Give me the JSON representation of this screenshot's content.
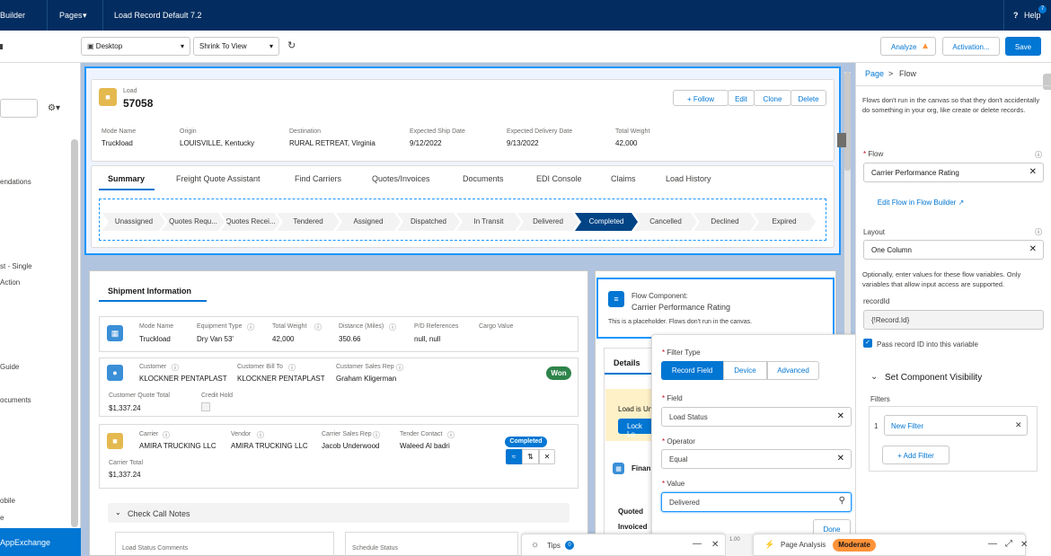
{
  "topbar": {
    "app": "Builder",
    "pages": "Pages",
    "title": "Load Record Default 7.2",
    "help": "Help",
    "help_badge": "7"
  },
  "toolbar": {
    "device": "Desktop",
    "zoom": "Shrink To View",
    "analyze": "Analyze",
    "activation": "Activation...",
    "save": "Save"
  },
  "left_panel": {
    "items": [
      "endations",
      "st - Single",
      "Action",
      "Guide",
      "ocuments",
      "obile",
      "e"
    ],
    "appexchange": "AppExchange"
  },
  "record": {
    "object_label": "Load",
    "name": "57058",
    "actions": [
      "Follow",
      "Edit",
      "Clone",
      "Delete"
    ],
    "fields": [
      {
        "label": "Mode Name",
        "value": "Truckload"
      },
      {
        "label": "Origin",
        "value": "LOUISVILLE, Kentucky"
      },
      {
        "label": "Destination",
        "value": "RURAL RETREAT, Virginia"
      },
      {
        "label": "Expected Ship Date",
        "value": "9/12/2022"
      },
      {
        "label": "Expected Delivery Date",
        "value": "9/13/2022"
      },
      {
        "label": "Total Weight",
        "value": "42,000"
      }
    ]
  },
  "tabs": [
    "Summary",
    "Freight Quote Assistant",
    "Find Carriers",
    "Quotes/Invoices",
    "Documents",
    "EDI Console",
    "Claims",
    "Load History"
  ],
  "path": {
    "stages": [
      "Unassigned",
      "Quotes Requ...",
      "Quotes Recei...",
      "Tendered",
      "Assigned",
      "Dispatched",
      "In Transit",
      "Delivered",
      "Completed",
      "Cancelled",
      "Declined",
      "Expired"
    ],
    "current": "Completed"
  },
  "shipment": {
    "title": "Shipment Information",
    "row1": [
      {
        "label": "Mode Name",
        "value": "Truckload"
      },
      {
        "label": "Equipment Type",
        "value": "Dry Van 53'"
      },
      {
        "label": "Total Weight",
        "value": "42,000"
      },
      {
        "label": "Distance (Miles)",
        "value": "350.66"
      },
      {
        "label": "P/D References",
        "value": "null, null"
      },
      {
        "label": "Cargo Value",
        "value": ""
      }
    ],
    "row2": [
      {
        "label": "Customer",
        "value": "KLOCKNER PENTAPLAST"
      },
      {
        "label": "Customer Bill To",
        "value": "KLOCKNER PENTAPLAST"
      },
      {
        "label": "Customer Sales Rep",
        "value": "Graham Kligerman"
      }
    ],
    "won": "Won",
    "row2b": [
      {
        "label": "Customer Quote Total",
        "value": "$1,337.24"
      },
      {
        "label": "Credit Hold",
        "value": ""
      }
    ],
    "row3": [
      {
        "label": "Carrier",
        "value": "AMIRA TRUCKING LLC"
      },
      {
        "label": "Vendor",
        "value": "AMIRA TRUCKING LLC"
      },
      {
        "label": "Carrier Sales Rep",
        "value": "Jacob Underwood"
      },
      {
        "label": "Tender Contact",
        "value": "Waleed Al badri"
      }
    ],
    "completed_badge": "Completed",
    "row3b": [
      {
        "label": "Carrier Total",
        "value": "$1,337.24"
      }
    ],
    "check_call": "Check Call Notes",
    "bottom_labels": [
      "Load Status Comments",
      "Schedule Status"
    ]
  },
  "flow_component": {
    "title1": "Flow Component:",
    "title2": "Carrier Performance Rating",
    "note": "This is a placeholder. Flows don't run in the canvas."
  },
  "details": {
    "tab": "Details",
    "notice": "Load is Un",
    "lock_btn": "Lock Lo",
    "finance": "Finan",
    "quoted": "Quoted",
    "invoiced": "Invoiced"
  },
  "popover": {
    "filter_type_label": "Filter Type",
    "filter_types": [
      "Record Field",
      "Device",
      "Advanced"
    ],
    "field_label": "Field",
    "field_value": "Load Status",
    "operator_label": "Operator",
    "operator_value": "Equal",
    "value_label": "Value",
    "value_value": "Delivered",
    "done": "Done"
  },
  "right_panel": {
    "breadcrumb_page": "Page",
    "breadcrumb_sep": ">",
    "breadcrumb_current": "Flow",
    "info": "Flows don't run in the canvas so that they don't accidentally do something in your org, like create or delete records.",
    "flow_label": "Flow",
    "flow_value": "Carrier Performance Rating",
    "edit_flow": "Edit Flow in Flow Builder",
    "layout_label": "Layout",
    "layout_value": "One Column",
    "vars_info": "Optionally, enter values for these flow variables. Only variables that allow input access are supported.",
    "record_id_label": "recordId",
    "record_id_value": "{!Record.Id}",
    "pass_record": "Pass record ID into this variable",
    "visibility": "Set Component Visibility",
    "filters_label": "Filters",
    "filter_index": "1",
    "new_filter": "New Filter",
    "add_filter": "Add Filter"
  },
  "dock": {
    "tips": "Tips",
    "tips_badge": "0",
    "page_analysis": "Page Analysis",
    "moderate": "Moderate",
    "zoom_value": "1.00"
  },
  "colors": {
    "brand": "#0176d3",
    "navy": "#032d60",
    "current_stage": "#014486",
    "won": "#2e844a",
    "warning": "#fe9339"
  }
}
